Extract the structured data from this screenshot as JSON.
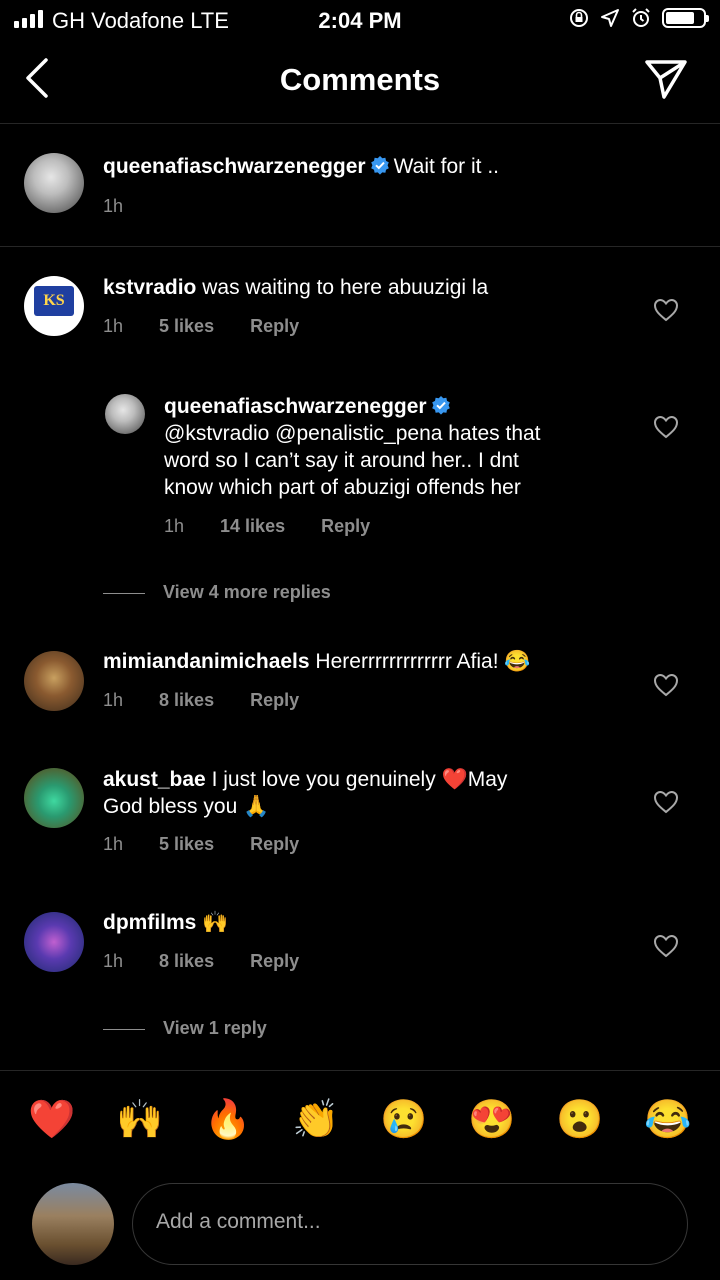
{
  "status": {
    "carrier": "GH Vodafone  LTE",
    "time": "2:04 PM"
  },
  "header": {
    "title": "Comments"
  },
  "caption": {
    "username": "queenafiaschwarzenegger",
    "text": "Wait for it ..",
    "time": "1h"
  },
  "comments": [
    {
      "username": "kstvradio",
      "text": "was waiting to here abuuzigi la",
      "time": "1h",
      "likes": "5 likes",
      "reply": "Reply"
    },
    {
      "username": "queenafiaschwarzenegger",
      "line1": "@kstvradio @penalistic_pena hates that",
      "line2": "word so I can’t say it around her.. I dnt",
      "line3": "know which part of abuzigi offends her",
      "time": "1h",
      "likes": "14 likes",
      "reply": "Reply"
    },
    {
      "username": "mimiandanimichaels",
      "text": "Hererrrrrrrrrrrrr Afia! 😂",
      "time": "1h",
      "likes": "8 likes",
      "reply": "Reply"
    },
    {
      "username": "akust_bae",
      "text": "I just love you genuinely ❤️May",
      "line2": "God bless you 🙏",
      "time": "1h",
      "likes": "5 likes",
      "reply": "Reply"
    },
    {
      "username": "dpmfilms",
      "text": "🙌",
      "time": "1h",
      "likes": "8 likes",
      "reply": "Reply"
    }
  ],
  "view_more_1": "View 4 more replies",
  "view_more_2": "View 1 reply",
  "emoji_bar": [
    "❤️",
    "🙌",
    "🔥",
    "👏",
    "😢",
    "😍",
    "😮",
    "😂"
  ],
  "input": {
    "placeholder": "Add a comment..."
  },
  "colors": {
    "background": "#000000",
    "muted": "#8e8e8e",
    "verified": "#3897f0"
  }
}
